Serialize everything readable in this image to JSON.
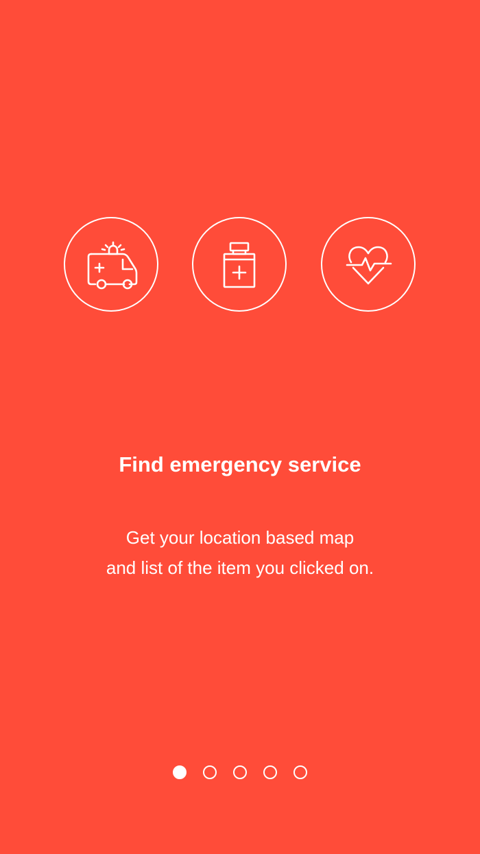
{
  "theme": {
    "background": "#ff4c39",
    "foreground": "#ffffff"
  },
  "icons": [
    {
      "name": "ambulance-icon"
    },
    {
      "name": "medicine-bottle-icon"
    },
    {
      "name": "heartbeat-icon"
    }
  ],
  "onboarding": {
    "title": "Find emergency service",
    "description_line1": "Get your location based map",
    "description_line2": "and list of the item you clicked on."
  },
  "pager": {
    "page_count": 5,
    "active_page": 1
  }
}
